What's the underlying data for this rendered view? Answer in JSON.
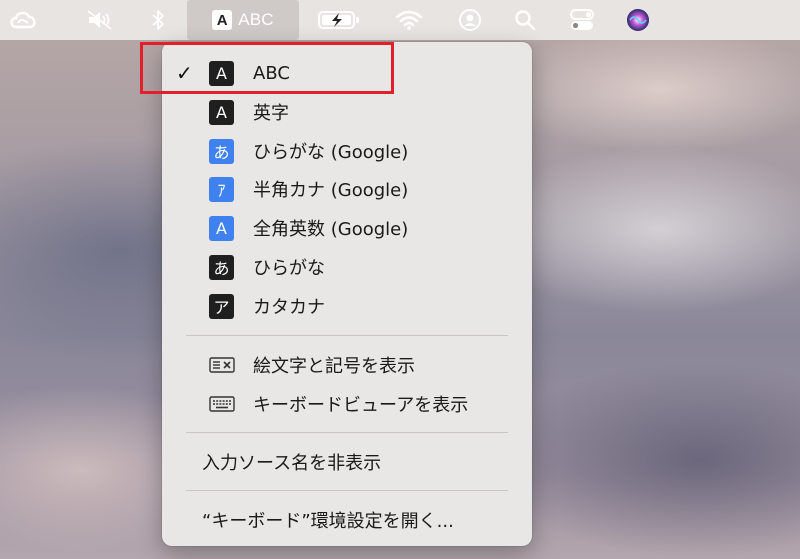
{
  "menubar": {
    "active_label": "ABC",
    "active_badge": "A",
    "icons": [
      "creative-cloud-icon",
      "speaker-muted-icon",
      "bluetooth-icon",
      "battery-charging-icon",
      "wifi-icon",
      "user-account-icon",
      "search-icon",
      "control-center-icon",
      "siri-icon"
    ]
  },
  "menu": {
    "sources": [
      {
        "label": "ABC",
        "badge": "A",
        "badge_style": "dark",
        "checked": true
      },
      {
        "label": "英字",
        "badge": "A",
        "badge_style": "dark",
        "checked": false
      },
      {
        "label": "ひらがな (Google)",
        "badge": "あ",
        "badge_style": "blue",
        "checked": false
      },
      {
        "label": "半角カナ (Google)",
        "badge": "ｱ",
        "badge_style": "blue",
        "checked": false
      },
      {
        "label": "全角英数 (Google)",
        "badge": "A",
        "badge_style": "blue",
        "checked": false
      },
      {
        "label": "ひらがな",
        "badge": "あ",
        "badge_style": "dark",
        "checked": false
      },
      {
        "label": "カタカナ",
        "badge": "ア",
        "badge_style": "dark",
        "checked": false
      }
    ],
    "check_glyph": "✓",
    "show_emoji": "絵文字と記号を表示",
    "show_keyboard_viewer": "キーボードビューアを表示",
    "hide_input_source_name": "入力ソース名を非表示",
    "open_keyboard_prefs": "“キーボード”環境設定を開く..."
  },
  "colors": {
    "highlight_border": "#e0212b",
    "badge_blue": "#3f82ef",
    "badge_dark": "#1f1f1f"
  }
}
